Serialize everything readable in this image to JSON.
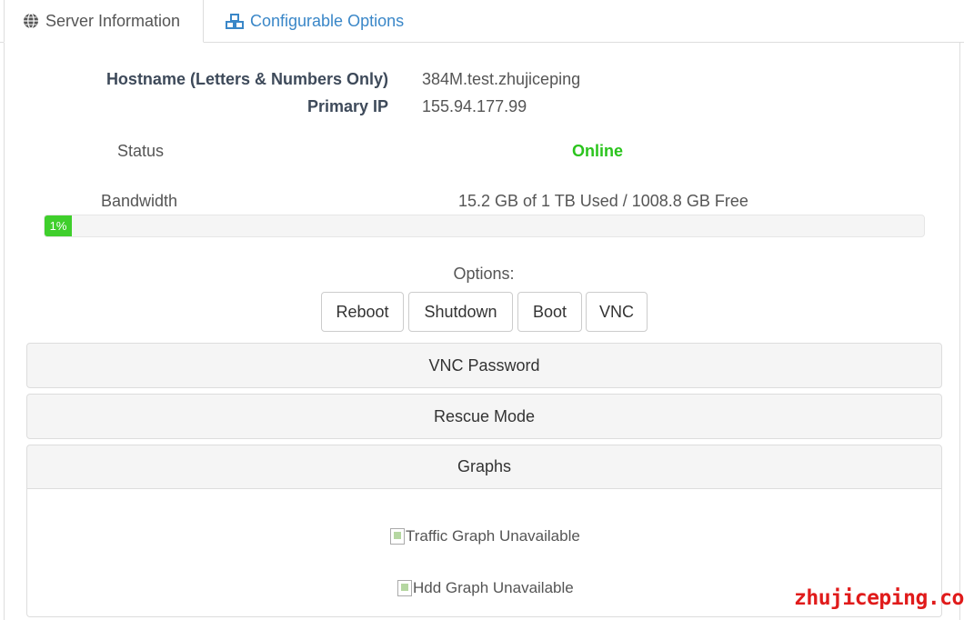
{
  "tabs": {
    "server_info": "Server Information",
    "configurable_options": "Configurable Options"
  },
  "info": {
    "hostname_label": "Hostname (Letters & Numbers Only)",
    "hostname_value": "384M.test.zhujiceping",
    "primary_ip_label": "Primary IP",
    "primary_ip_value": "155.94.177.99",
    "status_label": "Status",
    "status_value": "Online",
    "bandwidth_label": "Bandwidth",
    "bandwidth_value": "15.2 GB of 1 TB Used / 1008.8 GB Free",
    "bandwidth_percent_label": "1%",
    "bandwidth_percent": 1
  },
  "options": {
    "label": "Options:",
    "buttons": [
      "Reboot",
      "Shutdown",
      "Boot",
      "VNC"
    ]
  },
  "panels": {
    "vnc_password": "VNC Password",
    "rescue_mode": "Rescue Mode",
    "graphs": "Graphs"
  },
  "graphs": {
    "traffic_alt": "Traffic Graph Unavailable",
    "hdd_alt": "Hdd Graph Unavailable"
  },
  "watermark": "zhujiceping.com",
  "colors": {
    "link": "#3a87c8",
    "online": "#2bc41d",
    "progress": "#3fcf2c",
    "watermark": "#e01b1b"
  },
  "icons": {
    "server_info": "globe-icon",
    "configurable_options": "cubes-icon"
  }
}
